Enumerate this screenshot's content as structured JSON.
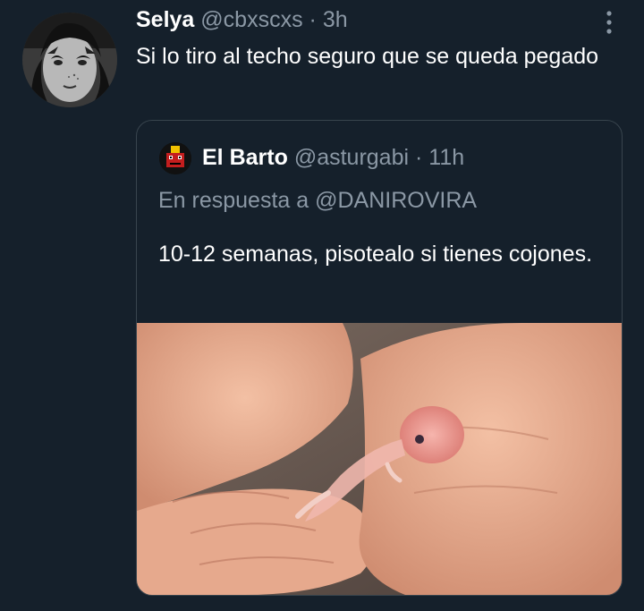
{
  "tweet": {
    "author_name": "Selya",
    "author_handle": "@cbxscxs",
    "separator": "·",
    "time": "3h",
    "text": "Si lo tiro al techo seguro que se queda pegado",
    "more_icon": "more-vertical-icon"
  },
  "quote": {
    "author_name": "El Barto",
    "author_handle": "@asturgabi",
    "separator": "·",
    "time": "11h",
    "reply_prefix": "En respuesta a",
    "reply_mention": "@DANIROVIRA",
    "text": "10-12 semanas, pisotealo si tienes cojones."
  },
  "colors": {
    "background": "#15202b",
    "secondary_text": "#8b98a5",
    "border": "#38444d"
  }
}
